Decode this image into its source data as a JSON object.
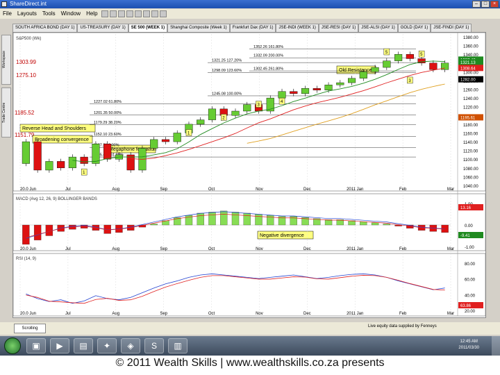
{
  "window": {
    "title": "ShareDirect.int"
  },
  "menu": [
    "File",
    "Layouts",
    "Tools",
    "Window",
    "Help"
  ],
  "tabs": [
    {
      "label": "SOUTH AFRICA BOND (DAY 1)",
      "active": false
    },
    {
      "label": "US-TREASURY (DAY 1)",
      "active": false
    },
    {
      "label": "SE 500 (WEEK 1)",
      "active": true
    },
    {
      "label": "Shanghai Composite (Week 1)",
      "active": false
    },
    {
      "label": "Frankfurt Dax (DAY 1)",
      "active": false
    },
    {
      "label": "JSE-INDI (WEEK 1)",
      "active": false
    },
    {
      "label": "JSE-RESI (DAY 1)",
      "active": false
    },
    {
      "label": "JSE-ALSI (DAY 1)",
      "active": false
    },
    {
      "label": "GOLD (DAY 1)",
      "active": false
    },
    {
      "label": "JSE-FINDI (DAY 1)",
      "active": false
    }
  ],
  "side_tabs": [
    "Workspace",
    "Trade Centre"
  ],
  "price_panel": {
    "left_prices": [
      "1303.99",
      "1275.10",
      "1185.52",
      "1151.79"
    ],
    "axis_labels": [
      "1380.00",
      "1360.00",
      "1340.00",
      "1320.00",
      "1300.00",
      "1280.00",
      "1260.00",
      "1240.00",
      "1220.00",
      "1200.00",
      "1180.00",
      "1160.00",
      "1140.00",
      "1120.00",
      "1100.00",
      "1080.00",
      "1060.00",
      "1040.00"
    ],
    "badges": [
      {
        "text": "1327.40",
        "color": "#1f8a1f"
      },
      {
        "text": "1321.13",
        "color": "#1f8a1f"
      },
      {
        "text": "1308.64",
        "color": "#e02020"
      },
      {
        "text": "1282.00",
        "color": "#000000"
      },
      {
        "text": "1195.61",
        "color": "#d05000"
      }
    ],
    "annotations": [
      "Reverse Head and Shoulders",
      "Broadening convergence",
      "Megaphone formation",
      "Old Resistance"
    ],
    "wave_labels": [
      "1",
      "2",
      "3",
      "4",
      "5",
      "5",
      "3",
      "1"
    ],
    "fib_labels": [
      "1352.26 161.80%",
      "1332.09 200.00%",
      "1302.45 261.80%",
      "1321.25 127.20%",
      "1298.09 123.60%",
      "1245.08 100.00%",
      "1227.02 61.80%",
      "1201.35 50.00%",
      "1179.29 38.20%",
      "1152.10 23.60%",
      "1127.21 0.00%",
      "1105.43 161.80%"
    ],
    "x_labels": [
      "20.0 Jun",
      "Jul",
      "Aug",
      "Sep",
      "Oct",
      "Nov",
      "Dec",
      "2011 Jan",
      "Feb",
      "Mar"
    ]
  },
  "macd_panel": {
    "header": "MACD (Avg 12, 26, 9)  BOLLINGER BANDS",
    "annotation": "Negative divergence",
    "axis_labels": [
      "1.00",
      "0.00",
      "-1.00"
    ],
    "badges": [
      {
        "text": "13.16",
        "color": "#e02020"
      },
      {
        "text": "-9.41",
        "color": "#1f8a1f"
      }
    ],
    "x_labels": [
      "20.0 Jun",
      "Jul",
      "Aug",
      "Sep",
      "Oct",
      "Nov",
      "Dec",
      "2011 Jan",
      "Feb",
      "Mar"
    ]
  },
  "rsi_panel": {
    "header": "RSI (14, 9)",
    "axis_labels": [
      "80.00",
      "60.00",
      "40.00",
      "20.00"
    ],
    "badges": [
      {
        "text": "63.86",
        "color": "#e02020"
      }
    ],
    "x_labels": [
      "20.0 Jun",
      "Jul",
      "Aug",
      "Sep",
      "Oct",
      "Nov",
      "Dec",
      "2011 Jan",
      "Feb",
      "Mar"
    ]
  },
  "status_bar": {
    "tab": "Scrolling",
    "message": "Live equity data supplied by Fenneys"
  },
  "taskbar": {
    "clock_time": "12:45 AM",
    "clock_date": "2011/03/30",
    "apps": [
      "folder-icon",
      "media-icon",
      "document-icon",
      "tools-icon",
      "network-icon",
      "skype-icon",
      "chart-icon"
    ]
  },
  "footer": "© 2011 Wealth Skills | www.wealthskills.co.za presents",
  "chart_data": {
    "type": "candlestick",
    "title": "",
    "x_labels": [
      "20.0 Jun",
      "Jul",
      "Aug",
      "Sep",
      "Oct",
      "Nov",
      "Dec",
      "2011 Jan",
      "Feb",
      "Mar"
    ],
    "ylim": [
      1040,
      1380
    ],
    "candles": [
      {
        "o": 1090,
        "c": 1140
      },
      {
        "o": 1140,
        "c": 1075
      },
      {
        "o": 1075,
        "c": 1095
      },
      {
        "o": 1095,
        "c": 1080
      },
      {
        "o": 1080,
        "c": 1105
      },
      {
        "o": 1105,
        "c": 1090
      },
      {
        "o": 1090,
        "c": 1135
      },
      {
        "o": 1135,
        "c": 1100
      },
      {
        "o": 1100,
        "c": 1110
      },
      {
        "o": 1110,
        "c": 1075
      },
      {
        "o": 1075,
        "c": 1125
      },
      {
        "o": 1125,
        "c": 1145
      },
      {
        "o": 1145,
        "c": 1140
      },
      {
        "o": 1140,
        "c": 1160
      },
      {
        "o": 1160,
        "c": 1180
      },
      {
        "o": 1180,
        "c": 1190
      },
      {
        "o": 1190,
        "c": 1215
      },
      {
        "o": 1215,
        "c": 1200
      },
      {
        "o": 1200,
        "c": 1210
      },
      {
        "o": 1210,
        "c": 1225
      },
      {
        "o": 1225,
        "c": 1210
      },
      {
        "o": 1210,
        "c": 1240
      },
      {
        "o": 1240,
        "c": 1255
      },
      {
        "o": 1255,
        "c": 1250
      },
      {
        "o": 1250,
        "c": 1262
      },
      {
        "o": 1262,
        "c": 1258
      },
      {
        "o": 1258,
        "c": 1270
      },
      {
        "o": 1270,
        "c": 1275
      },
      {
        "o": 1275,
        "c": 1285
      },
      {
        "o": 1285,
        "c": 1300
      },
      {
        "o": 1300,
        "c": 1310
      },
      {
        "o": 1310,
        "c": 1325
      },
      {
        "o": 1325,
        "c": 1340
      },
      {
        "o": 1340,
        "c": 1330
      },
      {
        "o": 1330,
        "c": 1320
      },
      {
        "o": 1320,
        "c": 1305
      },
      {
        "o": 1305,
        "c": 1320
      }
    ],
    "macd_histogram": [
      -18,
      -14,
      -10,
      -6,
      -4,
      -3,
      -5,
      -8,
      -7,
      -5,
      -2,
      1,
      4,
      7,
      9,
      11,
      12,
      13,
      12,
      11,
      10,
      9,
      8,
      8,
      7,
      6,
      5,
      5,
      4,
      3,
      2,
      1,
      -1,
      -3,
      -5,
      -6,
      -7
    ],
    "rsi": [
      38,
      30,
      25,
      28,
      22,
      26,
      35,
      30,
      28,
      32,
      40,
      48,
      55,
      60,
      66,
      70,
      72,
      70,
      68,
      66,
      64,
      66,
      68,
      70,
      67,
      64,
      66,
      69,
      71,
      72,
      70,
      66,
      60,
      55,
      50,
      45,
      48
    ]
  }
}
